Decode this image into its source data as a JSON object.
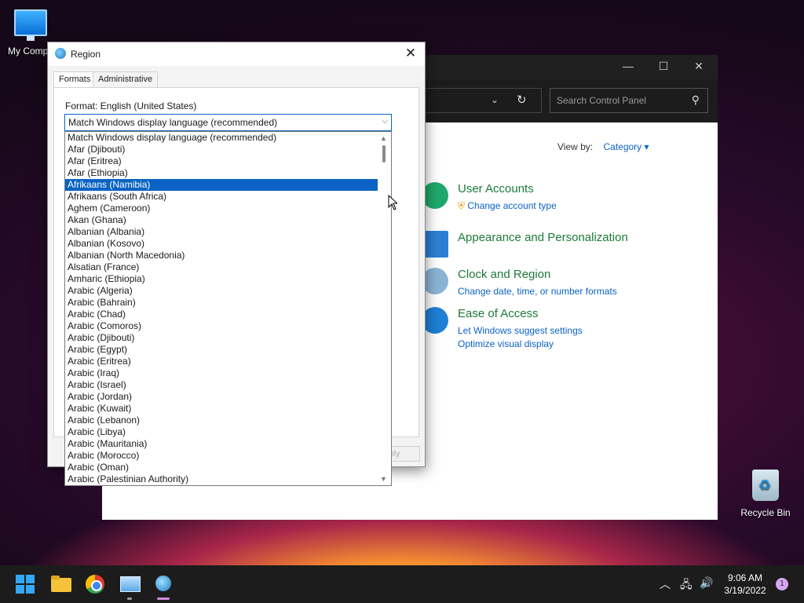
{
  "desktop": {
    "my_computer_label": "My Compu",
    "recycle_bin_label": "Recycle Bin"
  },
  "control_panel": {
    "search_placeholder": "Search Control Panel",
    "view_by_label": "View by:",
    "view_by_value": "Category",
    "categories": [
      {
        "title": "User Accounts",
        "links": [
          "Change account type"
        ]
      },
      {
        "title": "Appearance and Personalization",
        "links": []
      },
      {
        "title": "Clock and Region",
        "links": [
          "Change date, time, or number formats"
        ]
      },
      {
        "title": "Ease of Access",
        "links": [
          "Let Windows suggest settings",
          "Optimize visual display"
        ]
      }
    ]
  },
  "region_dialog": {
    "title": "Region",
    "tabs": [
      "Formats",
      "Administrative"
    ],
    "format_label": "Format: English (United States)",
    "combo_value": "Match Windows display language (recommended)",
    "apply_label": "Apply",
    "selected_index": 4,
    "options": [
      "Match Windows display language (recommended)",
      "Afar (Djibouti)",
      "Afar (Eritrea)",
      "Afar (Ethiopia)",
      "Afrikaans (Namibia)",
      "Afrikaans (South Africa)",
      "Aghem (Cameroon)",
      "Akan (Ghana)",
      "Albanian (Albania)",
      "Albanian (Kosovo)",
      "Albanian (North Macedonia)",
      "Alsatian (France)",
      "Amharic (Ethiopia)",
      "Arabic (Algeria)",
      "Arabic (Bahrain)",
      "Arabic (Chad)",
      "Arabic (Comoros)",
      "Arabic (Djibouti)",
      "Arabic (Egypt)",
      "Arabic (Eritrea)",
      "Arabic (Iraq)",
      "Arabic (Israel)",
      "Arabic (Jordan)",
      "Arabic (Kuwait)",
      "Arabic (Lebanon)",
      "Arabic (Libya)",
      "Arabic (Mauritania)",
      "Arabic (Morocco)",
      "Arabic (Oman)",
      "Arabic (Palestinian Authority)"
    ]
  },
  "taskbar": {
    "time": "9:06 AM",
    "date": "3/19/2022",
    "notification_count": "1"
  }
}
